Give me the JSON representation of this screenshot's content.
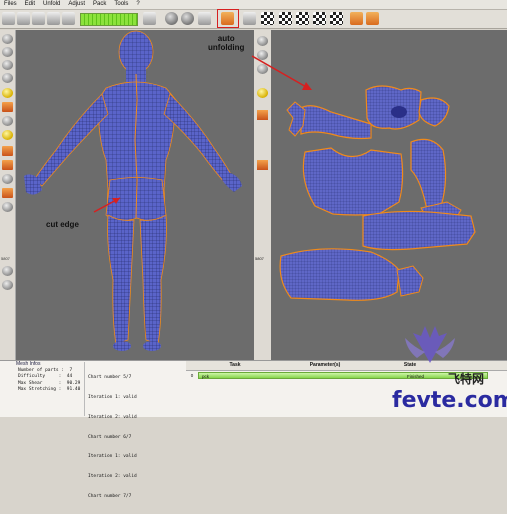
{
  "menu": [
    "Files",
    "Edit",
    "Unfold",
    "Adjust",
    "Pack",
    "Tools",
    "?"
  ],
  "annotations": {
    "auto_unfolding": "auto\nunfolding",
    "cut_edge": "cut edge"
  },
  "left_tool_labels": [
    "5807",
    "5807"
  ],
  "mesh_info": {
    "title": "Mesh Infos",
    "rows": [
      "Number of parts :  7",
      "Difficulty     :  44",
      "Max Shear      :  90.29",
      "Max Stretching :  91.40"
    ]
  },
  "log": [
    "Chart number 5/7",
    "Iteration 1: valid",
    "Iteration 2: valid",
    "Chart number 6/7",
    "Iteration 1: valid",
    "Iteration 2: valid",
    "Chart number 7/7"
  ],
  "tasks": {
    "headers": [
      "Task",
      "Parameter(s)",
      "State"
    ],
    "rows": [
      {
        "id": "0",
        "name": "pck",
        "state": "Finished",
        "progress": 1.0
      }
    ]
  },
  "watermark": {
    "site": "fevte.com",
    "brand": "飞特网"
  },
  "colors": {
    "accent_red": "#d62020",
    "seam_orange": "#f08a1a",
    "mesh_blue": "#5560c8"
  }
}
